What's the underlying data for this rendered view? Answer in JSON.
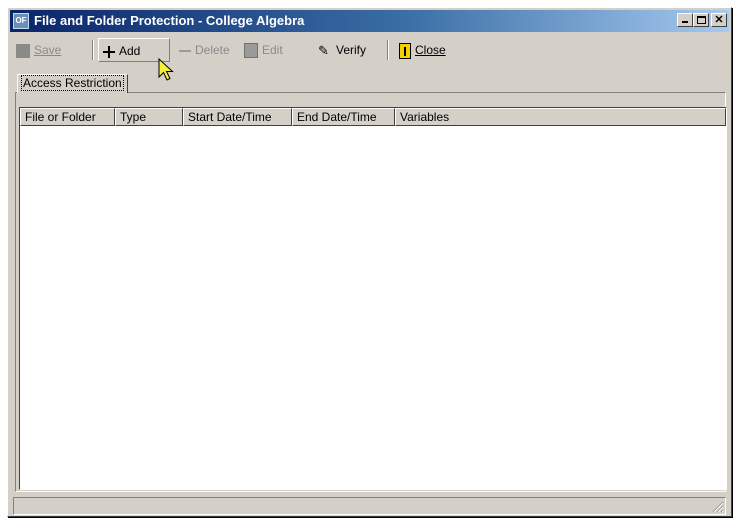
{
  "window": {
    "app_icon_text": "OF",
    "title": "File and Folder Protection - College Algebra"
  },
  "toolbar": {
    "save_label": "Save",
    "add_label": "Add",
    "delete_label": "Delete",
    "edit_label": "Edit",
    "verify_label": "Verify",
    "close_label": "Close"
  },
  "tabs": [
    {
      "label": "Access Restriction"
    }
  ],
  "grid": {
    "columns": [
      "File or Folder",
      "Type",
      "Start Date/Time",
      "End Date/Time",
      "Variables"
    ],
    "rows": []
  },
  "statusbar": {
    "text": ""
  },
  "colors": {
    "titlebar_start": "#0a246a",
    "titlebar_end": "#a6caf0",
    "face": "#d4d0c8",
    "close_icon": "#f2d000"
  }
}
